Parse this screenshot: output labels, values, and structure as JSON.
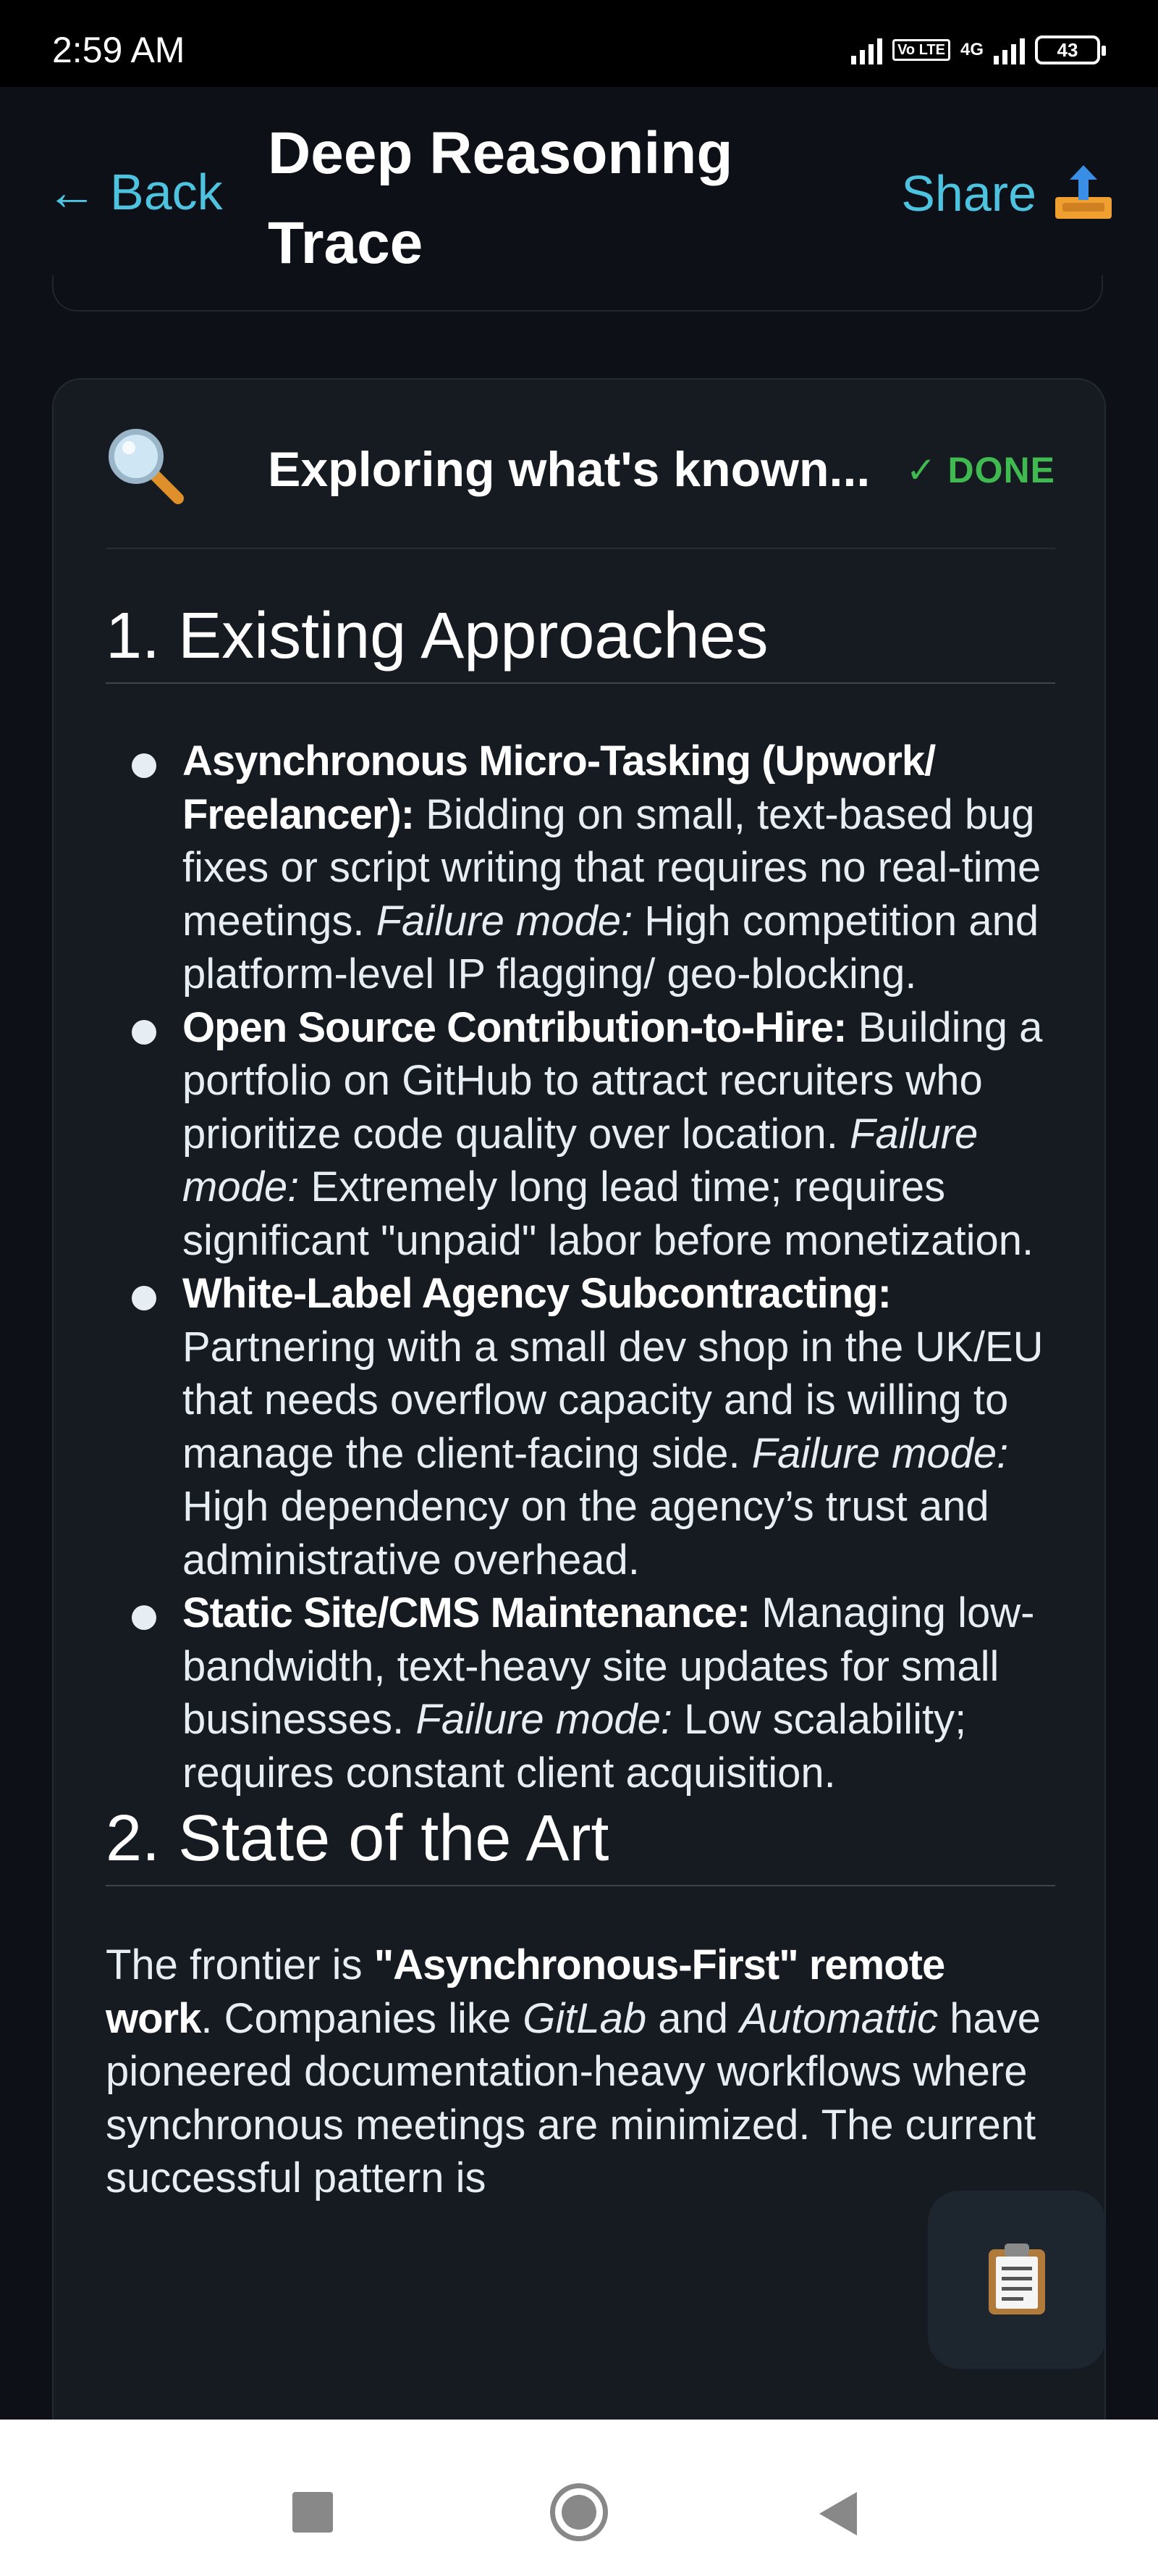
{
  "status_bar": {
    "time": "2:59 AM",
    "volte_tag": "Vo LTE",
    "network_type": "4G",
    "battery_percent": "43"
  },
  "header": {
    "back_arrow": "←",
    "back_label": "Back",
    "title": "Deep Reasoning Trace",
    "share_label": "Share",
    "link_color": "#4ec3e0"
  },
  "card": {
    "title": "Exploring what's known...",
    "status": "✓ DONE",
    "status_color": "#3fb950",
    "icon": "magnifying-glass-icon"
  },
  "section1": {
    "heading": "1. Existing Approaches",
    "items": [
      {
        "title": "Asynchronous Micro-Tasking (Upwork/ Freelancer):",
        "text": " Bidding on small, text-based bug fixes or script writing that requires no real-time meetings. ",
        "failure_label": "Failure mode:",
        "failure_text": " High competition and platform-level IP flagging/ geo-blocking."
      },
      {
        "title": "Open Source Contribution-to-Hire:",
        "text": " Building a portfolio on GitHub to attract recruiters who prioritize code quality over location. ",
        "failure_label": "Failure mode:",
        "failure_text": " Extremely long lead time; requires significant \"unpaid\" labor before monetization."
      },
      {
        "title": "White-Label Agency Subcontracting:",
        "text": " Partnering with a small dev shop in the UK/EU that needs overflow capacity and is willing to manage the client-facing side. ",
        "failure_label": "Failure mode:",
        "failure_text": " High dependency on the agency’s trust and administrative overhead."
      },
      {
        "title": "Static Site/CMS Maintenance:",
        "text": " Managing low-bandwidth, text-heavy site updates for small businesses. ",
        "failure_label": "Failure mode:",
        "failure_text": " Low scalability; requires constant client acquisition."
      }
    ]
  },
  "section2": {
    "heading": "2. State of the Art",
    "p_start": "The frontier is ",
    "p_bold": "\"Asynchronous-First\" remote work",
    "p_mid1": ". Companies like ",
    "company1": "GitLab",
    "p_mid2": " and ",
    "company2": "Automattic",
    "p_end": " have pioneered documentation-heavy workflows where synchronous meetings are minimized. The current successful pattern is"
  },
  "floating_button": {
    "icon": "clipboard-icon"
  },
  "nav_bar": {
    "recents": "recents-icon",
    "home": "home-icon",
    "back": "back-triangle-icon"
  }
}
